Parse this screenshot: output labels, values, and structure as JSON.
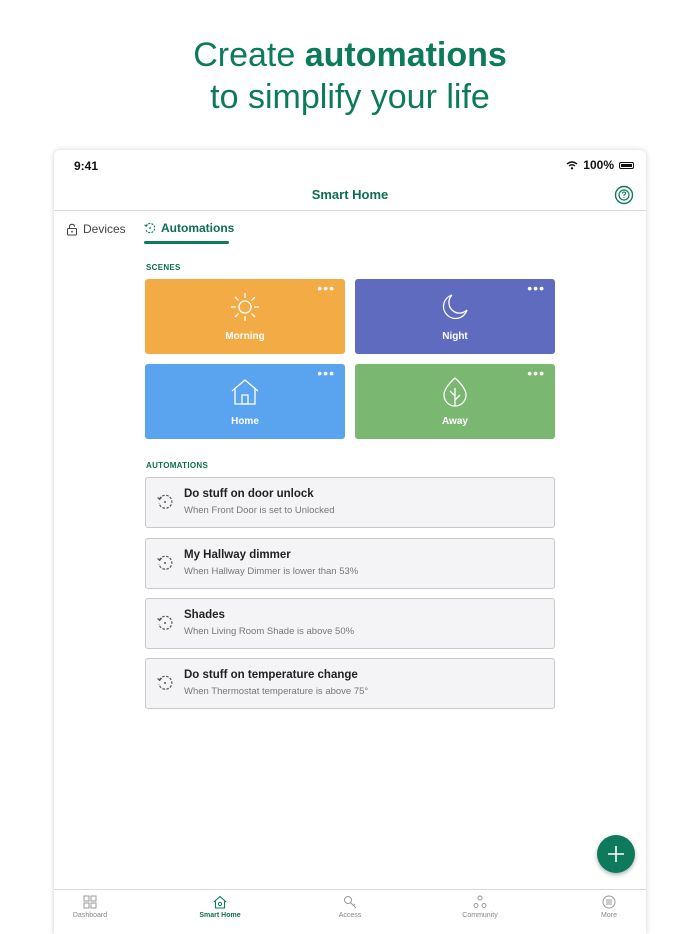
{
  "hero": {
    "line1_regular": "Create ",
    "line1_bold": "automations",
    "line2": "to simplify your life"
  },
  "status": {
    "time": "9:41",
    "battery": "100%"
  },
  "nav": {
    "title": "Smart Home",
    "help_icon": "help-circle-icon"
  },
  "tabs": [
    {
      "label": "Devices",
      "icon": "lock-icon",
      "active": false
    },
    {
      "label": "Automations",
      "icon": "automation-icon",
      "active": true
    }
  ],
  "scenes_label": "SCENES",
  "scenes": [
    {
      "label": "Morning",
      "icon": "sun-icon",
      "color": "#f2ab45",
      "more": "•••"
    },
    {
      "label": "Night",
      "icon": "moon-icon",
      "color": "#5f6bbe",
      "more": "•••"
    },
    {
      "label": "Home",
      "icon": "house-icon",
      "color": "#5aa3ee",
      "more": "•••"
    },
    {
      "label": "Away",
      "icon": "leaf-icon",
      "color": "#7ab871",
      "more": "•••"
    }
  ],
  "automations_label": "AUTOMATIONS",
  "automations": [
    {
      "title": "Do stuff on door unlock",
      "subtitle": "When Front Door is set to Unlocked"
    },
    {
      "title": "My Hallway dimmer",
      "subtitle": "When Hallway Dimmer is lower than 53%"
    },
    {
      "title": "Shades",
      "subtitle": "When Living Room Shade is above 50%"
    },
    {
      "title": "Do stuff on temperature change",
      "subtitle": "When Thermostat temperature is above 75°"
    }
  ],
  "fab_icon": "plus-icon",
  "bottom_nav": [
    {
      "label": "Dashboard",
      "icon": "grid-icon",
      "active": false
    },
    {
      "label": "Smart Home",
      "icon": "smart-home-icon",
      "active": true
    },
    {
      "label": "Access",
      "icon": "key-icon",
      "active": false
    },
    {
      "label": "Community",
      "icon": "community-icon",
      "active": false
    },
    {
      "label": "More",
      "icon": "more-icon",
      "active": false
    }
  ],
  "colors": {
    "brand": "#0c7a5b",
    "card_bg": "#f4f4f6"
  }
}
